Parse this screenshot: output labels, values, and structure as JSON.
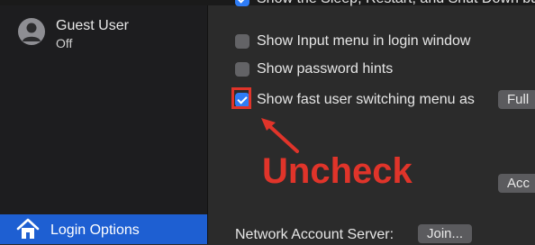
{
  "sidebar": {
    "guest_user": {
      "name": "Guest User",
      "status": "Off",
      "icon": "person-avatar-icon"
    },
    "login_options": {
      "label": "Login Options",
      "icon": "house-icon"
    }
  },
  "options": [
    {
      "label": "Show the Sleep, Restart, and Shut Down buttons",
      "checked": true
    },
    {
      "label": "Show Input menu in login window",
      "checked": false
    },
    {
      "label": "Show password hints",
      "checked": false
    },
    {
      "label": "Show fast user switching menu as",
      "checked": true
    }
  ],
  "fast_switch_dropdown": {
    "value": "Full"
  },
  "network_account_server": {
    "label": "Network Account Server:",
    "button": "Join..."
  },
  "accessibility_button": {
    "label": "Acc"
  },
  "annotation": {
    "text": "Uncheck",
    "color": "#e0342a"
  },
  "colors": {
    "accent": "#2e7cf6",
    "selected_bg": "#1e5fd2",
    "annotation": "#e0342a"
  }
}
